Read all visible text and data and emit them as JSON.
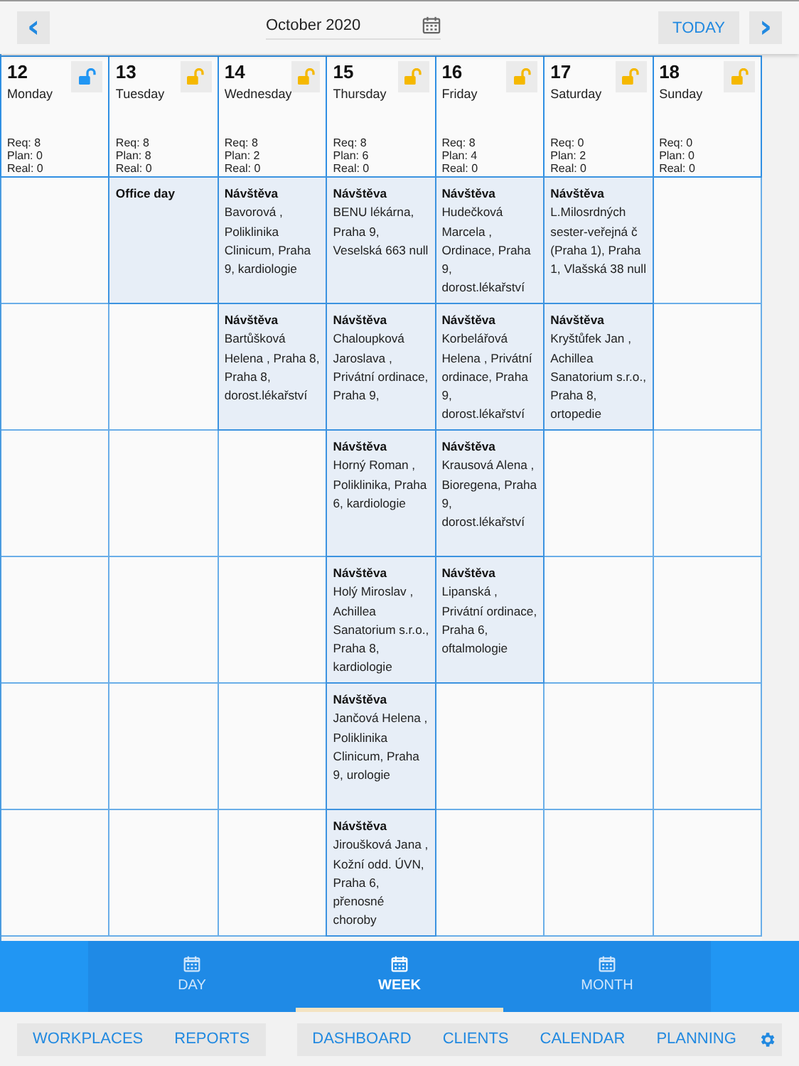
{
  "toolbar": {
    "prev": "‹",
    "month": "October 2020",
    "today": "TODAY",
    "next": "›"
  },
  "days": [
    {
      "date": "12",
      "weekday": "Monday",
      "req": "Req: 8",
      "plan": "Plan: 0",
      "real": "Real: 0",
      "lock": {
        "color": "#2196f3"
      }
    },
    {
      "date": "13",
      "weekday": "Tuesday",
      "req": "Req: 8",
      "plan": "Plan: 8",
      "real": "Real: 0",
      "lock": {
        "color": "#f5b800"
      }
    },
    {
      "date": "14",
      "weekday": "Wednesday",
      "req": "Req: 8",
      "plan": "Plan: 2",
      "real": "Real: 0",
      "lock": {
        "color": "#f5b800"
      }
    },
    {
      "date": "15",
      "weekday": "Thursday",
      "req": "Req: 8",
      "plan": "Plan: 6",
      "real": "Real: 0",
      "lock": {
        "color": "#f5b800"
      }
    },
    {
      "date": "16",
      "weekday": "Friday",
      "req": "Req: 8",
      "plan": "Plan: 4",
      "real": "Real: 0",
      "lock": {
        "color": "#f5b800"
      }
    },
    {
      "date": "17",
      "weekday": "Saturday",
      "req": "Req: 0",
      "plan": "Plan: 2",
      "real": "Real: 0",
      "lock": {
        "color": "#f5b800"
      }
    },
    {
      "date": "18",
      "weekday": "Sunday",
      "req": "Req: 0",
      "plan": "Plan: 0",
      "real": "Real: 0",
      "lock": {
        "color": "#f5b800"
      }
    }
  ],
  "rows": [
    {
      "cells": [
        {
          "kind": "empty"
        },
        {
          "kind": "event",
          "title": "Office day"
        },
        {
          "kind": "event",
          "title": "Návštěva",
          "text": "Bavorová , Poliklinika Clinicum, Praha 9, kardiologie"
        },
        {
          "kind": "event",
          "title": "Návštěva",
          "text": "BENU lékárna, Praha 9, Veselská 663 null"
        },
        {
          "kind": "event",
          "title": "Návštěva",
          "text": "Hudečková Marcela , Ordinace, Praha 9, dorost.lékařství"
        },
        {
          "kind": "event",
          "title": "Návštěva",
          "text": "L.Milosrdných sester-veřejná č (Praha 1), Praha 1, Vlašská 38 null"
        },
        {
          "kind": "empty"
        }
      ]
    },
    {
      "cells": [
        {
          "kind": "empty"
        },
        {
          "kind": "empty"
        },
        {
          "kind": "event",
          "title": "Návštěva",
          "text": "Bartůšková Helena , Praha 8, Praha 8, dorost.lékařství"
        },
        {
          "kind": "event",
          "title": "Návštěva",
          "text": "Chaloupková Jaroslava , Privátní ordinace, Praha 9,"
        },
        {
          "kind": "event",
          "title": "Návštěva",
          "text": "Korbelářová Helena , Privátní ordinace, Praha 9, dorost.lékařství"
        },
        {
          "kind": "event",
          "title": "Návštěva",
          "text": "Kryštůfek Jan , Achillea Sanatorium s.r.o., Praha 8, ortopedie"
        },
        {
          "kind": "empty"
        }
      ]
    },
    {
      "cells": [
        {
          "kind": "empty"
        },
        {
          "kind": "empty"
        },
        {
          "kind": "empty"
        },
        {
          "kind": "event",
          "title": "Návštěva",
          "text": "Horný Roman , Poliklinika, Praha 6, kardiologie"
        },
        {
          "kind": "event",
          "title": "Návštěva",
          "text": "Krausová Alena , Bioregena, Praha 9, dorost.lékařství"
        },
        {
          "kind": "empty"
        },
        {
          "kind": "empty"
        }
      ]
    },
    {
      "cells": [
        {
          "kind": "empty"
        },
        {
          "kind": "empty"
        },
        {
          "kind": "empty"
        },
        {
          "kind": "event",
          "title": "Návštěva",
          "text": "Holý Miroslav , Achillea Sanatorium s.r.o., Praha 8, kardiologie"
        },
        {
          "kind": "event",
          "title": "Návštěva",
          "text": "Lipanská , Privátní ordinace, Praha 6, oftalmologie"
        },
        {
          "kind": "empty"
        },
        {
          "kind": "empty"
        }
      ]
    },
    {
      "cells": [
        {
          "kind": "empty"
        },
        {
          "kind": "empty"
        },
        {
          "kind": "empty"
        },
        {
          "kind": "event",
          "title": "Návštěva",
          "text": "Jančová Helena , Poliklinika Clinicum, Praha 9, urologie"
        },
        {
          "kind": "empty"
        },
        {
          "kind": "empty"
        },
        {
          "kind": "empty"
        }
      ]
    },
    {
      "cells": [
        {
          "kind": "empty"
        },
        {
          "kind": "empty"
        },
        {
          "kind": "empty"
        },
        {
          "kind": "event",
          "title": "Návštěva",
          "text": "Jiroušková Jana , Kožní odd. ÚVN, Praha 6, přenosné choroby"
        },
        {
          "kind": "empty"
        },
        {
          "kind": "empty"
        },
        {
          "kind": "empty"
        }
      ]
    }
  ],
  "view_tabs": [
    {
      "label": "DAY",
      "selected": false
    },
    {
      "label": "WEEK",
      "selected": true
    },
    {
      "label": "MONTH",
      "selected": false
    }
  ],
  "nav": {
    "left": [
      "WORKPLACES",
      "REPORTS"
    ],
    "center": [
      "DASHBOARD",
      "CLIENTS",
      "CALENDAR",
      "PLANNING"
    ]
  }
}
